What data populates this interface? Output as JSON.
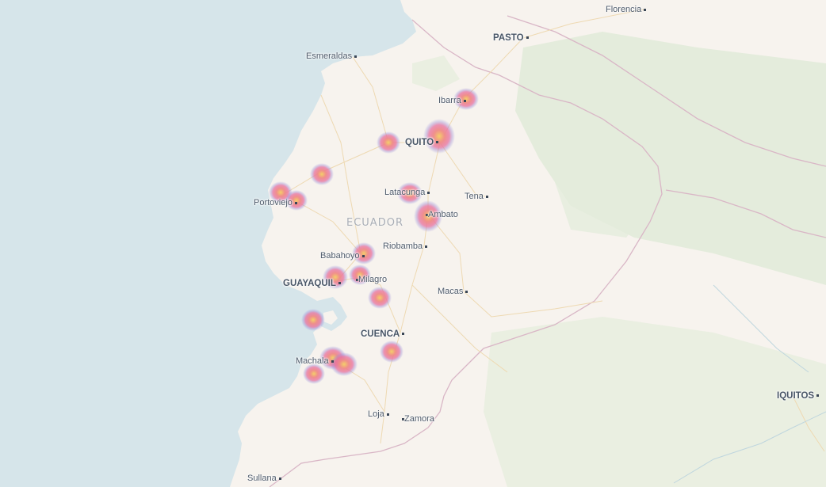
{
  "map": {
    "colors": {
      "sea": "#d6e5ea",
      "land": "#f7f3ee",
      "forest": "#e4ecdc",
      "border": "#d9b6c6",
      "road": "#eed9b2",
      "heat_outer": "#9b8cd8",
      "heat_mid": "#e8709e",
      "heat_core": "#f4cf6a"
    },
    "country_label": "ECUADOR",
    "cities": [
      {
        "id": "florencia",
        "name": "Florencia"
      },
      {
        "id": "pasto",
        "name": "PASTO"
      },
      {
        "id": "esmeraldas",
        "name": "Esmeraldas"
      },
      {
        "id": "ibarra",
        "name": "Ibarra"
      },
      {
        "id": "quito",
        "name": "QUITO"
      },
      {
        "id": "latacunga",
        "name": "Latacunga"
      },
      {
        "id": "tena",
        "name": "Tena"
      },
      {
        "id": "portoviejo",
        "name": "Portoviejo"
      },
      {
        "id": "ambato",
        "name": "Ambato"
      },
      {
        "id": "riobamba",
        "name": "Riobamba"
      },
      {
        "id": "babahoyo",
        "name": "Babahoyo"
      },
      {
        "id": "guayaquil",
        "name": "GUAYAQUIL"
      },
      {
        "id": "milagro",
        "name": "Milagro"
      },
      {
        "id": "macas",
        "name": "Macas"
      },
      {
        "id": "cuenca",
        "name": "CUENCA"
      },
      {
        "id": "machala",
        "name": "Machala"
      },
      {
        "id": "iquitos",
        "name": "IQUITOS"
      },
      {
        "id": "loja",
        "name": "Loja"
      },
      {
        "id": "zamora",
        "name": "Zamora"
      },
      {
        "id": "sullana",
        "name": "Sullana"
      }
    ],
    "heatmap_layer": "heat-blob"
  }
}
